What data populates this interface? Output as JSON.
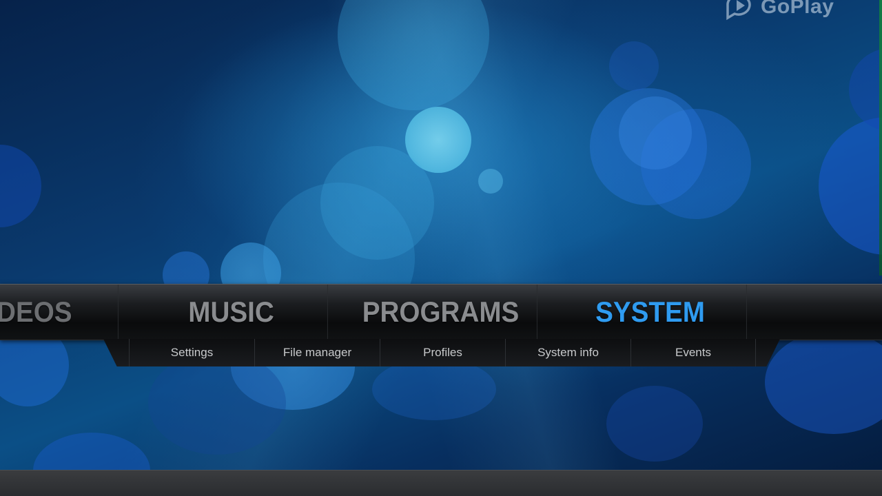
{
  "watermark": {
    "text": "GoPlay",
    "icon": "play-bubble-icon"
  },
  "main_menu": {
    "items": [
      {
        "label": "VIDEOS",
        "state": "faded"
      },
      {
        "label": "MUSIC",
        "state": "normal"
      },
      {
        "label": "PROGRAMS",
        "state": "normal"
      },
      {
        "label": "SYSTEM",
        "state": "active"
      }
    ],
    "active_color": "#2f9bf0",
    "inactive_color": "#8a8c8f"
  },
  "sub_menu": {
    "items": [
      {
        "label": "Settings"
      },
      {
        "label": "File manager"
      },
      {
        "label": "Profiles"
      },
      {
        "label": "System info"
      },
      {
        "label": "Events"
      }
    ]
  },
  "theme": {
    "background": "#0a3a6e",
    "accent": "#2f9bf0"
  }
}
